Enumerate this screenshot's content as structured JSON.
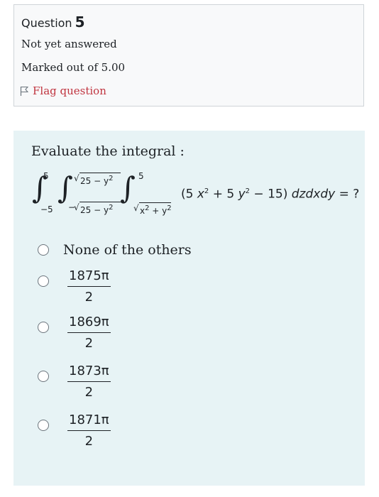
{
  "question": {
    "label": "Question",
    "number": "5",
    "status": "Not yet answered",
    "marks": "Marked out of 5.00",
    "flag_label": "Flag question"
  },
  "prompt": "Evaluate the integral :",
  "integral": {
    "outer_lower": "−5",
    "outer_upper": "5",
    "middle_lower_sign": "−",
    "middle_lower_radicand": "25 − y",
    "middle_upper_radicand": "25 − y",
    "inner_lower_radicand": "x  + y",
    "inner_upper": "5",
    "integrand": "(5 x  + 5 y  − 15) dzdxdy = ?"
  },
  "options": [
    {
      "label": "None of the others"
    },
    {
      "numerator": "1875π",
      "denominator": "2"
    },
    {
      "numerator": "1869π",
      "denominator": "2"
    },
    {
      "numerator": "1873π",
      "denominator": "2"
    },
    {
      "numerator": "1871π",
      "denominator": "2"
    }
  ]
}
